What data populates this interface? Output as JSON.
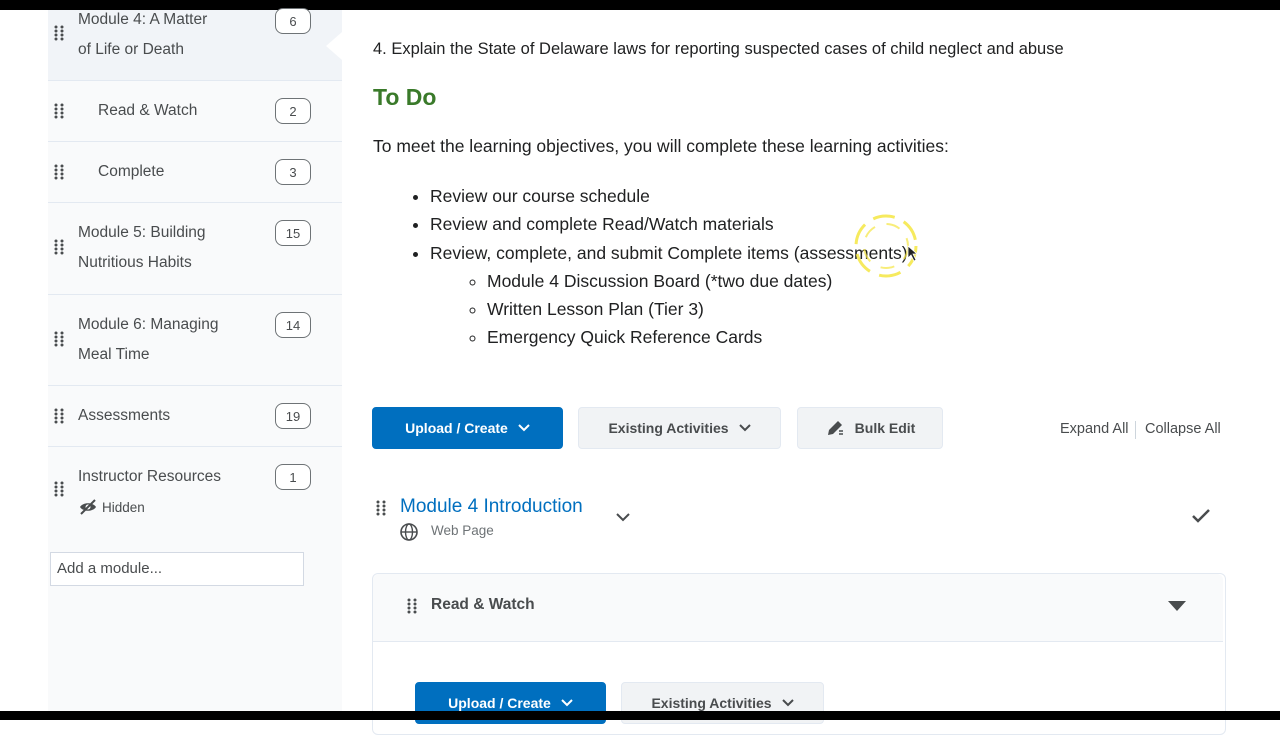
{
  "sidebar": {
    "modules": [
      {
        "title_line1": "Module 4: A Matter",
        "title_line2": "of Life or Death",
        "count": "6"
      },
      {
        "title_line1": "Read & Watch",
        "count": "2"
      },
      {
        "title_line1": "Complete",
        "count": "3"
      },
      {
        "title_line1": "Module 5: Building",
        "title_line2": "Nutritious Habits",
        "count": "15"
      },
      {
        "title_line1": "Module 6: Managing",
        "title_line2": "Meal Time",
        "count": "14"
      },
      {
        "title_line1": "Assessments",
        "count": "19"
      },
      {
        "title_line1": "Instructor Resources",
        "count": "1",
        "status": "Hidden"
      }
    ],
    "add_module_placeholder": "Add a module..."
  },
  "main": {
    "objective": "4. Explain the State of Delaware laws for reporting suspected cases of child neglect and abuse",
    "todo_heading": "To Do",
    "todo_intro": "To meet the learning objectives, you will complete these learning activities:",
    "activities": [
      "Review our course schedule",
      "Review and complete Read/Watch materials",
      "Review, complete, and submit Complete items (assessments)"
    ],
    "sub_activities": [
      "Module 4 Discussion Board (*two due dates)",
      "Written Lesson Plan (Tier 3)",
      "Emergency Quick Reference Cards"
    ]
  },
  "toolbar": {
    "upload_create": "Upload / Create",
    "existing_activities": "Existing Activities",
    "bulk_edit": "Bulk Edit",
    "expand_all": "Expand All",
    "collapse_all": "Collapse All"
  },
  "topic": {
    "title": "Module 4 Introduction",
    "type": "Web Page"
  },
  "submodule": {
    "title": "Read & Watch",
    "upload_create": "Upload / Create",
    "existing_activities": "Existing Activities"
  },
  "colors": {
    "primary": "#006fbf",
    "todo_green": "#3a7a2a"
  }
}
